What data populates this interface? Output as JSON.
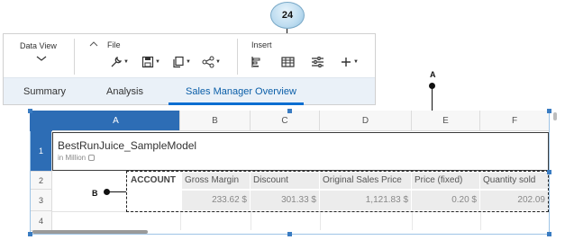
{
  "callouts": {
    "number": "24",
    "a": "A",
    "b": "B"
  },
  "toolbar": {
    "data_view_label": "Data View",
    "file_label": "File",
    "insert_label": "Insert",
    "icons": [
      "wrench-icon",
      "save-icon",
      "copy-icon",
      "share-icon",
      "chart-icon",
      "table-icon",
      "filter-icon",
      "add-icon"
    ]
  },
  "tabs": [
    {
      "label": "Summary"
    },
    {
      "label": "Analysis"
    },
    {
      "label": "Sales Manager Overview",
      "active": true
    }
  ],
  "grid": {
    "columns": [
      "A",
      "B",
      "C",
      "D",
      "E",
      "F"
    ],
    "rows": [
      "1",
      "2",
      "3",
      "4"
    ],
    "title": "BestRunJuice_SampleModel",
    "subtitle": "in Million",
    "account_label": "ACCOUNT",
    "measures": [
      "Gross Margin",
      "Discount",
      "Original Sales Price",
      "Price (fixed)",
      "Quantity sold"
    ],
    "values": [
      "233.62 $",
      "301.33 $",
      "1,121.83 $",
      "0.20 $",
      "202.09"
    ]
  },
  "colors": {
    "accent": "#0a6ed1",
    "selected_header": "#2d6db5",
    "tab_bar": "#eaf1f8"
  }
}
